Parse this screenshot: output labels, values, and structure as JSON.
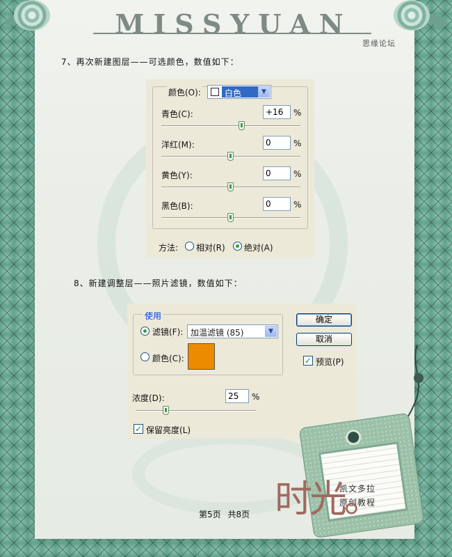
{
  "header": {
    "title": "MISSYUAN",
    "forum": "思缘论坛"
  },
  "step7": {
    "text": "7、再次新建图层——可选颜色，数值如下："
  },
  "selective_color": {
    "color_label": "颜色(O):",
    "color_value": "白色",
    "rows": [
      {
        "label": "青色(C):",
        "value": "+16",
        "unit": "%",
        "slider": 0.58
      },
      {
        "label": "洋红(M):",
        "value": "0",
        "unit": "%",
        "slider": 0.5
      },
      {
        "label": "黄色(Y):",
        "value": "0",
        "unit": "%",
        "slider": 0.5
      },
      {
        "label": "黑色(B):",
        "value": "0",
        "unit": "%",
        "slider": 0.5
      }
    ],
    "method_label": "方法:",
    "method_relative": "相对(R)",
    "method_absolute": "绝对(A)",
    "method_selected": "绝对(A)"
  },
  "step8": {
    "text": "8、新建调整层——照片滤镜，数值如下："
  },
  "photo_filter": {
    "group_label": "使用",
    "filter_label": "滤镜(F):",
    "filter_value": "加温滤镜 (85)",
    "color_label": "颜色(C):",
    "swatch_color": "#ec8a00",
    "ok_label": "确定",
    "cancel_label": "取消",
    "preview_label": "预览(P)",
    "density_label": "浓度(D):",
    "density_value": "25",
    "density_unit": "%",
    "density_slider": 0.25,
    "preserve_label": "保留亮度(L)",
    "preview_checked": true,
    "preserve_checked": true,
    "filter_selected": true
  },
  "tag": {
    "line1": "凯文多拉",
    "line2": "原创教程",
    "logo": "时光。"
  },
  "footer": {
    "page": "第5页",
    "total": "共8页"
  }
}
